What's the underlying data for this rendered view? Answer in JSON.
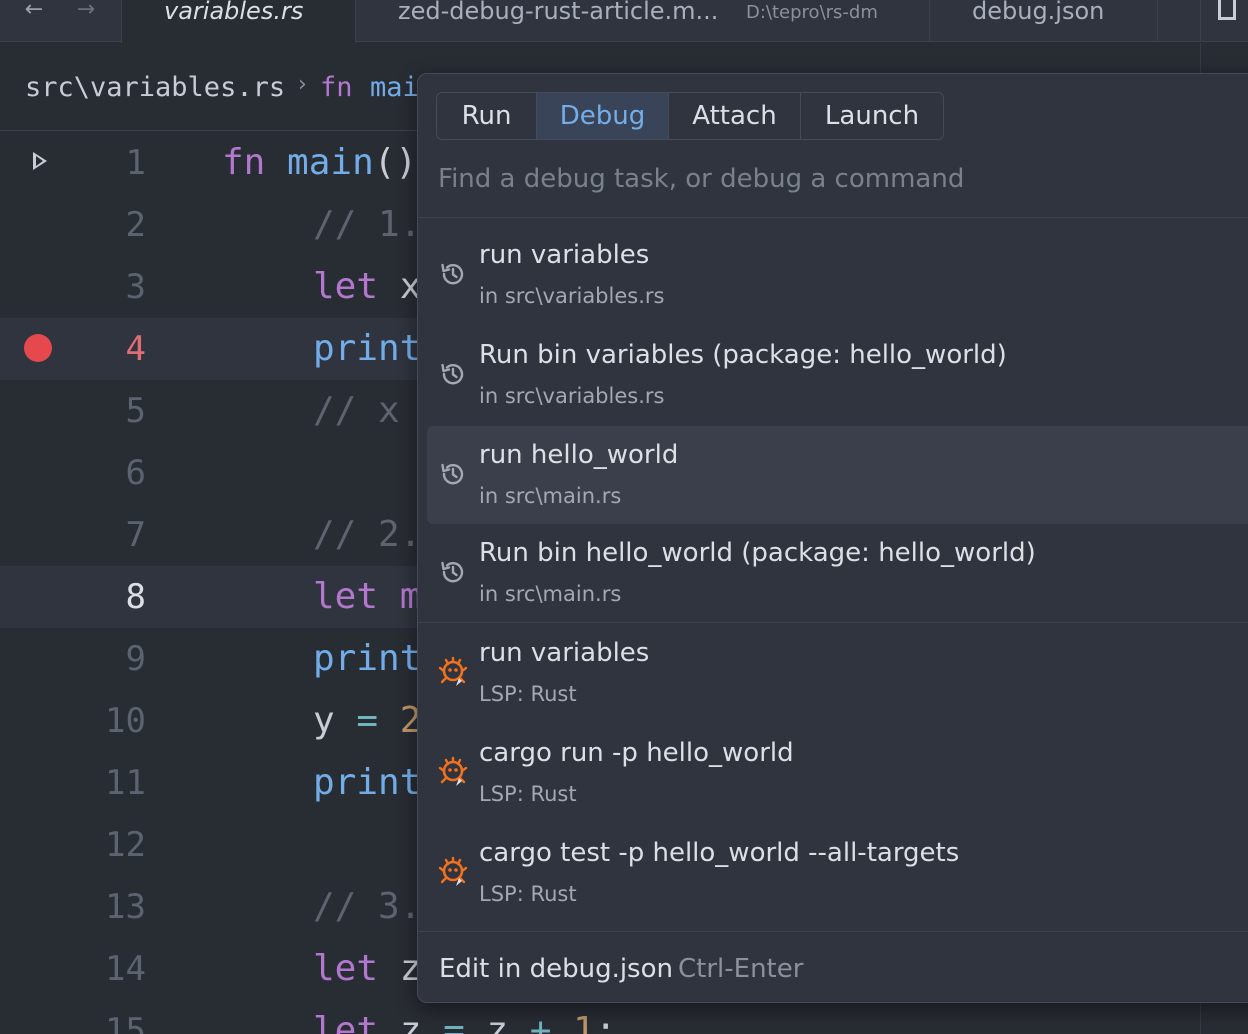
{
  "tabs": [
    {
      "label": "variables.rs",
      "active": true
    },
    {
      "label": "zed-debug-rust-article.m...",
      "path": "D:\\tepro\\rs-dm",
      "active": false
    },
    {
      "label": "debug.json",
      "active": false
    }
  ],
  "breadcrumb": {
    "file": "src\\variables.rs",
    "separator": "›",
    "fn_keyword": "fn",
    "fn_name": "mai"
  },
  "editor": {
    "lines": [
      {
        "n": "1"
      },
      {
        "n": "2"
      },
      {
        "n": "3"
      },
      {
        "n": "4"
      },
      {
        "n": "5"
      },
      {
        "n": "6"
      },
      {
        "n": "7"
      },
      {
        "n": "8"
      },
      {
        "n": "9"
      },
      {
        "n": "10"
      },
      {
        "n": "11"
      },
      {
        "n": "12"
      },
      {
        "n": "13"
      },
      {
        "n": "14"
      },
      {
        "n": "15"
      }
    ],
    "code": {
      "l1_kw": "fn",
      "l1_fn": "main",
      "l1_rest": "()",
      "l2": "// 1.",
      "l3_kw": "let",
      "l3_rest": " x",
      "l4": "print",
      "l5": "// x",
      "l7": "// 2.",
      "l8_kw": "let",
      "l8_rest": " m",
      "l9": "print",
      "l10_var": "y",
      "l10_op": " = ",
      "l10_num": "2",
      "l11": "print",
      "l13": "// 3.",
      "l14_kw": "let",
      "l14_rest": " z",
      "l15_kw": "let",
      "l15_var": " z",
      "l15_op": " = ",
      "l15_var2": "z",
      "l15_op2": " + ",
      "l15_num": "1",
      "l15_end": ";"
    }
  },
  "popover": {
    "mode_tabs": [
      {
        "label": "Run",
        "selected": false
      },
      {
        "label": "Debug",
        "selected": true
      },
      {
        "label": "Attach",
        "selected": false
      },
      {
        "label": "Launch",
        "selected": false
      }
    ],
    "search_placeholder": "Find a debug task, or debug a command",
    "items": [
      {
        "title": "run variables",
        "subtitle": "in src\\variables.rs",
        "icon": "history-icon"
      },
      {
        "title": "Run bin variables (package: hello_world)",
        "subtitle": "in src\\variables.rs",
        "icon": "history-icon"
      },
      {
        "title": "run hello_world",
        "subtitle": "in src\\main.rs",
        "icon": "history-icon"
      },
      {
        "title": "Run bin hello_world (package: hello_world)",
        "subtitle": "in src\\main.rs",
        "icon": "history-icon"
      },
      {
        "title": "run variables",
        "subtitle": "LSP: Rust",
        "icon": "rust-lsp-icon"
      },
      {
        "title": "cargo run -p hello_world",
        "subtitle": "LSP: Rust",
        "icon": "rust-lsp-icon"
      },
      {
        "title": "cargo test -p hello_world --all-targets",
        "subtitle": "LSP: Rust",
        "icon": "rust-lsp-icon"
      }
    ],
    "footer": {
      "action": "Edit in debug.json",
      "shortcut": "Ctrl-Enter"
    }
  },
  "colors": {
    "accent": "#74ade8",
    "breakpoint": "#e5484d",
    "lsp_icon": "#f2711c"
  }
}
